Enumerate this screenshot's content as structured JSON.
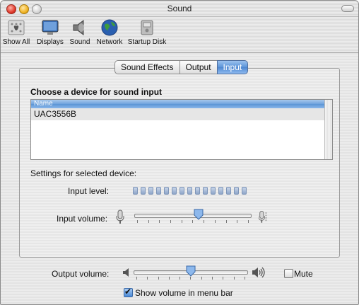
{
  "window": {
    "title": "Sound"
  },
  "toolbar": {
    "items": [
      {
        "label": "Show All",
        "icon": "apple-grid-icon"
      },
      {
        "label": "Displays",
        "icon": "display-icon"
      },
      {
        "label": "Sound",
        "icon": "speaker-icon"
      },
      {
        "label": "Network",
        "icon": "globe-icon"
      },
      {
        "label": "Startup Disk",
        "icon": "disk-icon"
      }
    ]
  },
  "tabs": [
    {
      "label": "Sound Effects",
      "selected": false
    },
    {
      "label": "Output",
      "selected": false
    },
    {
      "label": "Input",
      "selected": true
    }
  ],
  "input_pane": {
    "heading": "Choose a device for sound input",
    "table": {
      "columns": [
        "Name"
      ],
      "rows": [
        [
          "UAC3556B"
        ]
      ]
    },
    "settings_heading": "Settings for selected device:",
    "input_level_label": "Input level:",
    "input_level_segments": 15,
    "input_volume_label": "Input volume:",
    "input_volume_value": 0.55
  },
  "footer": {
    "output_volume_label": "Output volume:",
    "output_volume_value": 0.5,
    "mute_label": "Mute",
    "mute_checked": false,
    "menu_bar_label": "Show volume in menu bar",
    "menu_bar_checked": true
  },
  "colors": {
    "accent": "#5a93d8",
    "meter": "#8ea6c8"
  }
}
